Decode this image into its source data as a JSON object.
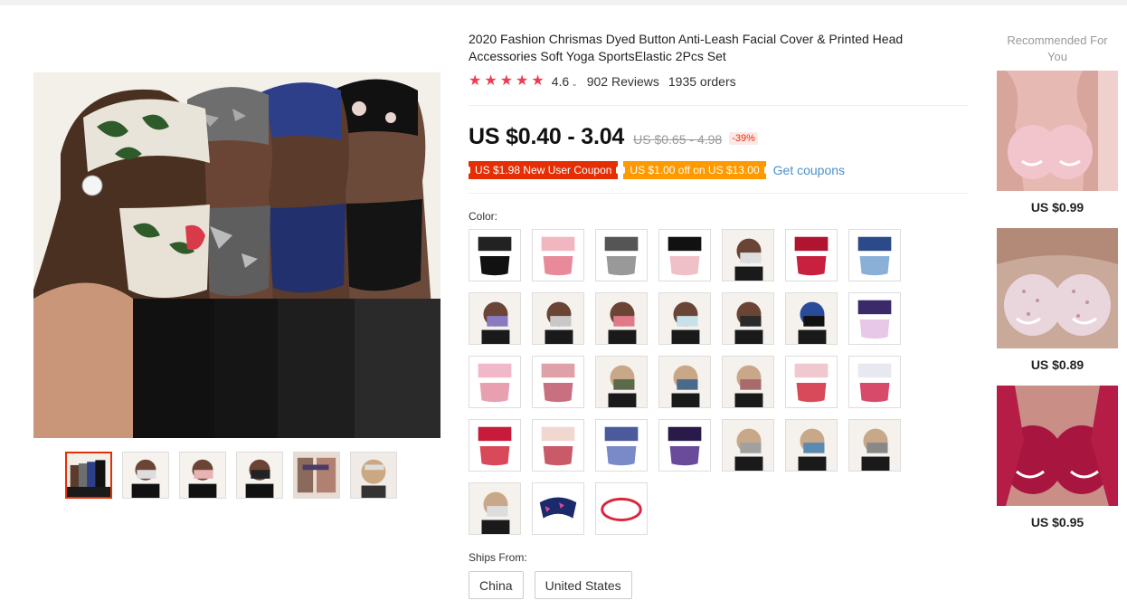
{
  "product": {
    "title": "2020 Fashion Chrismas Dyed Button Anti-Leash Facial Cover & Printed Head Accessories Soft Yoga SportsElastic 2Pcs Set",
    "rating": "4.6",
    "reviews": "902 Reviews",
    "orders": "1935 orders",
    "price": "US $0.40 - 3.04",
    "old_price": "US $0.65 - 4.98",
    "discount": "-39%",
    "coupons": [
      "US $1.98 New User Coupon",
      "US $1.00 off on US $13.00"
    ],
    "get_coupons": "Get coupons",
    "color_label": "Color:",
    "ships_label": "Ships From:",
    "ships_from": [
      "China",
      "United States"
    ]
  },
  "colors": {
    "accent_red": "#e62e04",
    "coupon_orange": "#ff9900",
    "star": "#f03c4f",
    "link": "#4a90c8"
  },
  "swatch_count": 31,
  "thumbnail_count": 6,
  "recommended": {
    "title": "Recommended For You",
    "items": [
      {
        "price": "US $0.99"
      },
      {
        "price": "US $0.89"
      },
      {
        "price": "US $0.95"
      }
    ]
  }
}
